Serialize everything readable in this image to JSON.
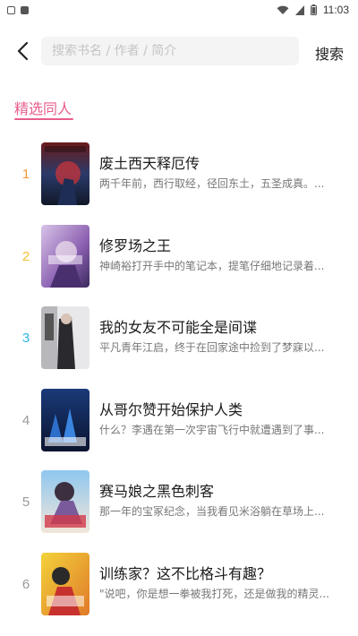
{
  "status": {
    "time": "11:03"
  },
  "search": {
    "placeholder": "搜索书名 / 作者 / 简介",
    "value": "",
    "button_label": "搜索"
  },
  "section": {
    "title": "精选同人",
    "accent": "#e85d8e"
  },
  "rank_colors": [
    "#f39a3b",
    "#f5c03a",
    "#2fb5e6",
    "#999999",
    "#999999",
    "#999999"
  ],
  "books": [
    {
      "rank": "1",
      "title": "废土西天释厄传",
      "desc": "两千年前，西行取经，径回东土，五圣成真。..."
    },
    {
      "rank": "2",
      "title": "修罗场之王",
      "desc": "神崎裕打开手中的笔记本，提笔仔细地记录着..."
    },
    {
      "rank": "3",
      "title": "我的女友不可能全是间谍",
      "desc": "平凡青年江启，终于在回家途中捡到了梦寐以..."
    },
    {
      "rank": "4",
      "title": "从哥尔赞开始保护人类",
      "desc": "什么？李遇在第一次宇宙飞行中就遭遇到了事..."
    },
    {
      "rank": "5",
      "title": "赛马娘之黑色刺客",
      "desc": "那一年的宝冢纪念，当我看见米浴躺在草场上..."
    },
    {
      "rank": "6",
      "title": "训练家？这不比格斗有趣？",
      "desc": "\"说吧，你是想一拳被我打死，还是做我的精灵..."
    }
  ]
}
